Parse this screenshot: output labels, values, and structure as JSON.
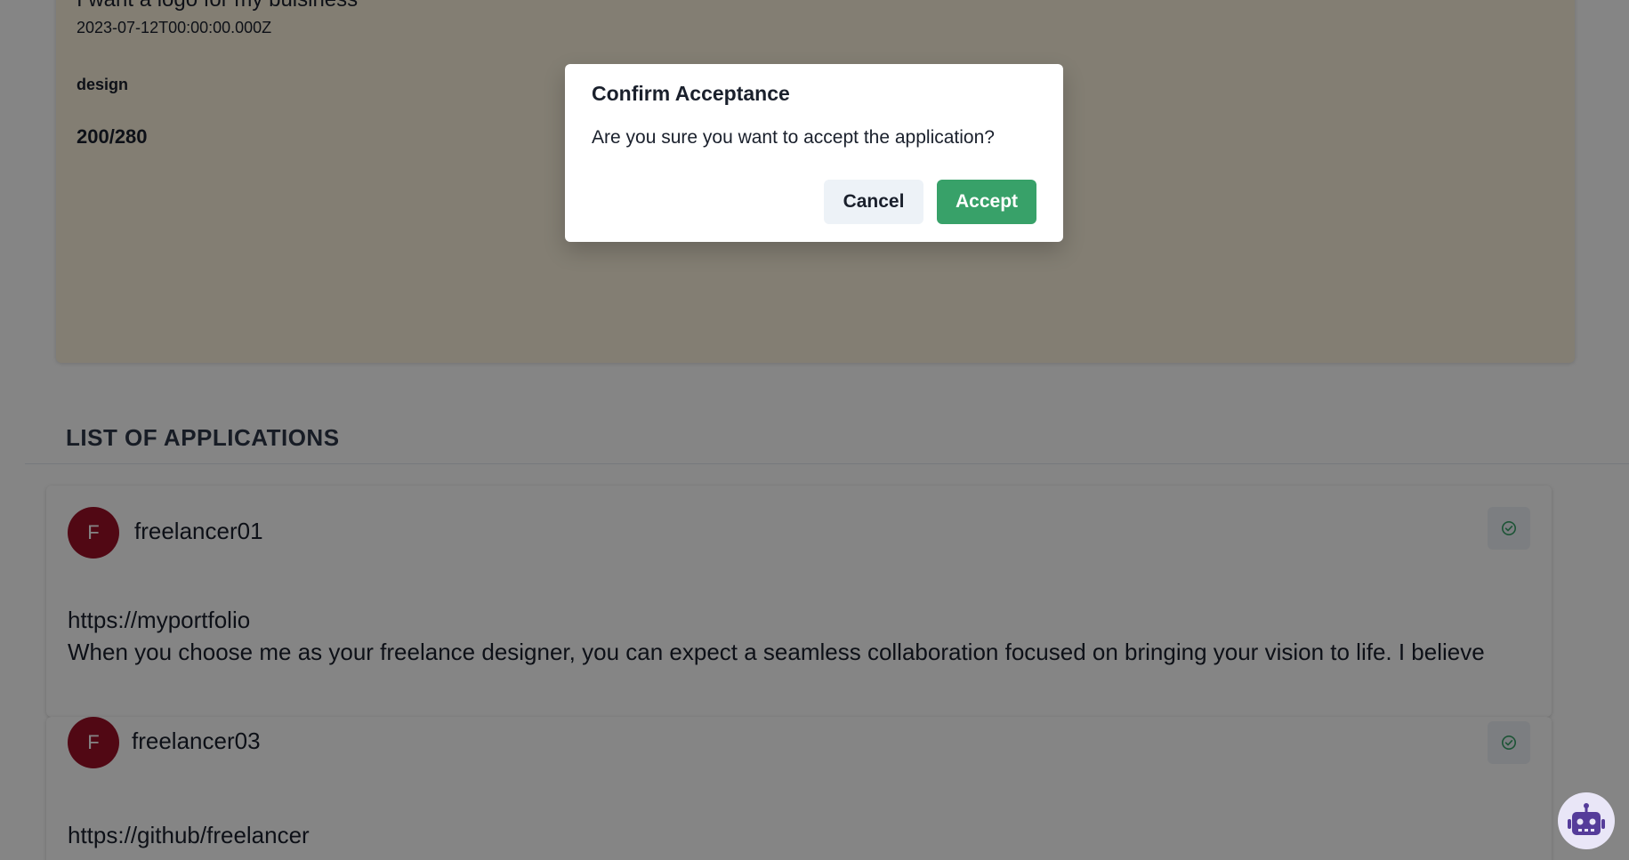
{
  "job": {
    "title": "I want a logo for my buisiness",
    "date": "2023-07-12T00:00:00.000Z",
    "category": "design",
    "budget": "200/280",
    "card_color": "#fbf1dc"
  },
  "applications_section": {
    "heading": "LIST OF APPLICATIONS",
    "items": [
      {
        "avatar_letter": "F",
        "username": "freelancer01",
        "portfolio": "https://myportfolio",
        "description": "When you choose me as your freelance designer, you can expect a seamless collaboration focused on bringing your vision to life. I believe",
        "action_icon": "check-circle-icon"
      },
      {
        "avatar_letter": "F",
        "username": "freelancer03",
        "portfolio": "https://github/freelancer",
        "action_icon": "check-circle-icon"
      }
    ]
  },
  "modal": {
    "title": "Confirm Acceptance",
    "body": "Are you sure you want to accept the application?",
    "cancel_label": "Cancel",
    "accept_label": "Accept"
  },
  "colors": {
    "accept_green": "#38a169",
    "avatar_red": "#9b1028",
    "bot_purple": "#553c9a"
  },
  "bot": {
    "icon": "robot-icon"
  }
}
